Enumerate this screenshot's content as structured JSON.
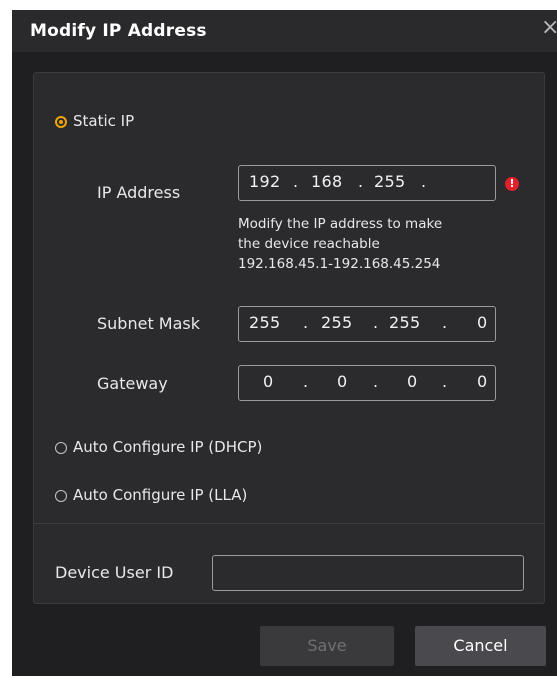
{
  "dialog": {
    "title": "Modify IP Address",
    "close_icon": "×"
  },
  "static_ip": {
    "label": "Static IP",
    "selected": true,
    "ip_address": {
      "label": "IP Address",
      "segments": [
        "192",
        "168",
        "255",
        ""
      ],
      "error": true,
      "error_icon": "!",
      "hint_lines": [
        "Modify the IP address to make",
        "the device reachable",
        "192.168.45.1-192.168.45.254"
      ]
    },
    "subnet_mask": {
      "label": "Subnet Mask",
      "segments": [
        "255",
        "255",
        "255",
        "0"
      ]
    },
    "gateway": {
      "label": "Gateway",
      "segments": [
        "0",
        "0",
        "0",
        "0"
      ]
    }
  },
  "dhcp": {
    "label": "Auto Configure IP (DHCP)",
    "selected": false
  },
  "lla": {
    "label": "Auto Configure IP (LLA)",
    "selected": false
  },
  "device_user_id": {
    "label": "Device User ID",
    "value": ""
  },
  "buttons": {
    "save": "Save",
    "cancel": "Cancel"
  },
  "colors": {
    "accent": "#f0a500",
    "error": "#e0202a",
    "background": "#1f1f22",
    "panel": "#2b2b2e"
  }
}
